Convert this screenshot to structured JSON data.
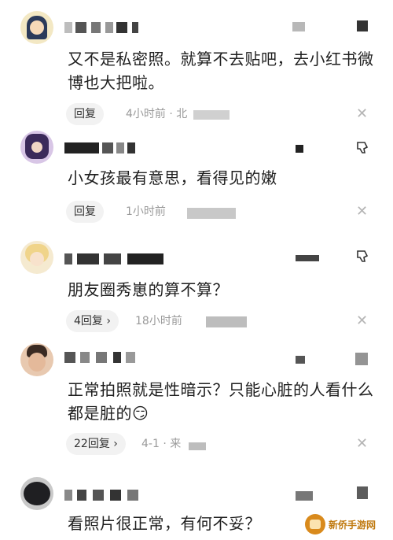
{
  "comments": [
    {
      "text": "又不是私密照。就算不去贴吧，去小红书微博也大把啦。",
      "reply_label": "回复",
      "time": "4小时前 · 北"
    },
    {
      "text": "小女孩最有意思，看得见的嫩",
      "reply_label": "回复",
      "time": "1小时前"
    },
    {
      "text": "朋友圈秀崽的算不算？",
      "reply_label": "4回复",
      "time": "18小时前"
    },
    {
      "text": "正常拍照就是性暗示？只能心脏的人看什么都是脏的",
      "emoji": "😏",
      "reply_label": "22回复",
      "time": "4-1 · 来"
    },
    {
      "text": "看照片很正常，有何不妥？"
    }
  ],
  "close_glyph": "✕",
  "reply_chevron": "›",
  "watermark": {
    "text": "新侨手游网"
  },
  "colors": {
    "meta": "#9a9a9a",
    "reply_bg": "#f2f2f2",
    "text": "#1f1f1f"
  }
}
